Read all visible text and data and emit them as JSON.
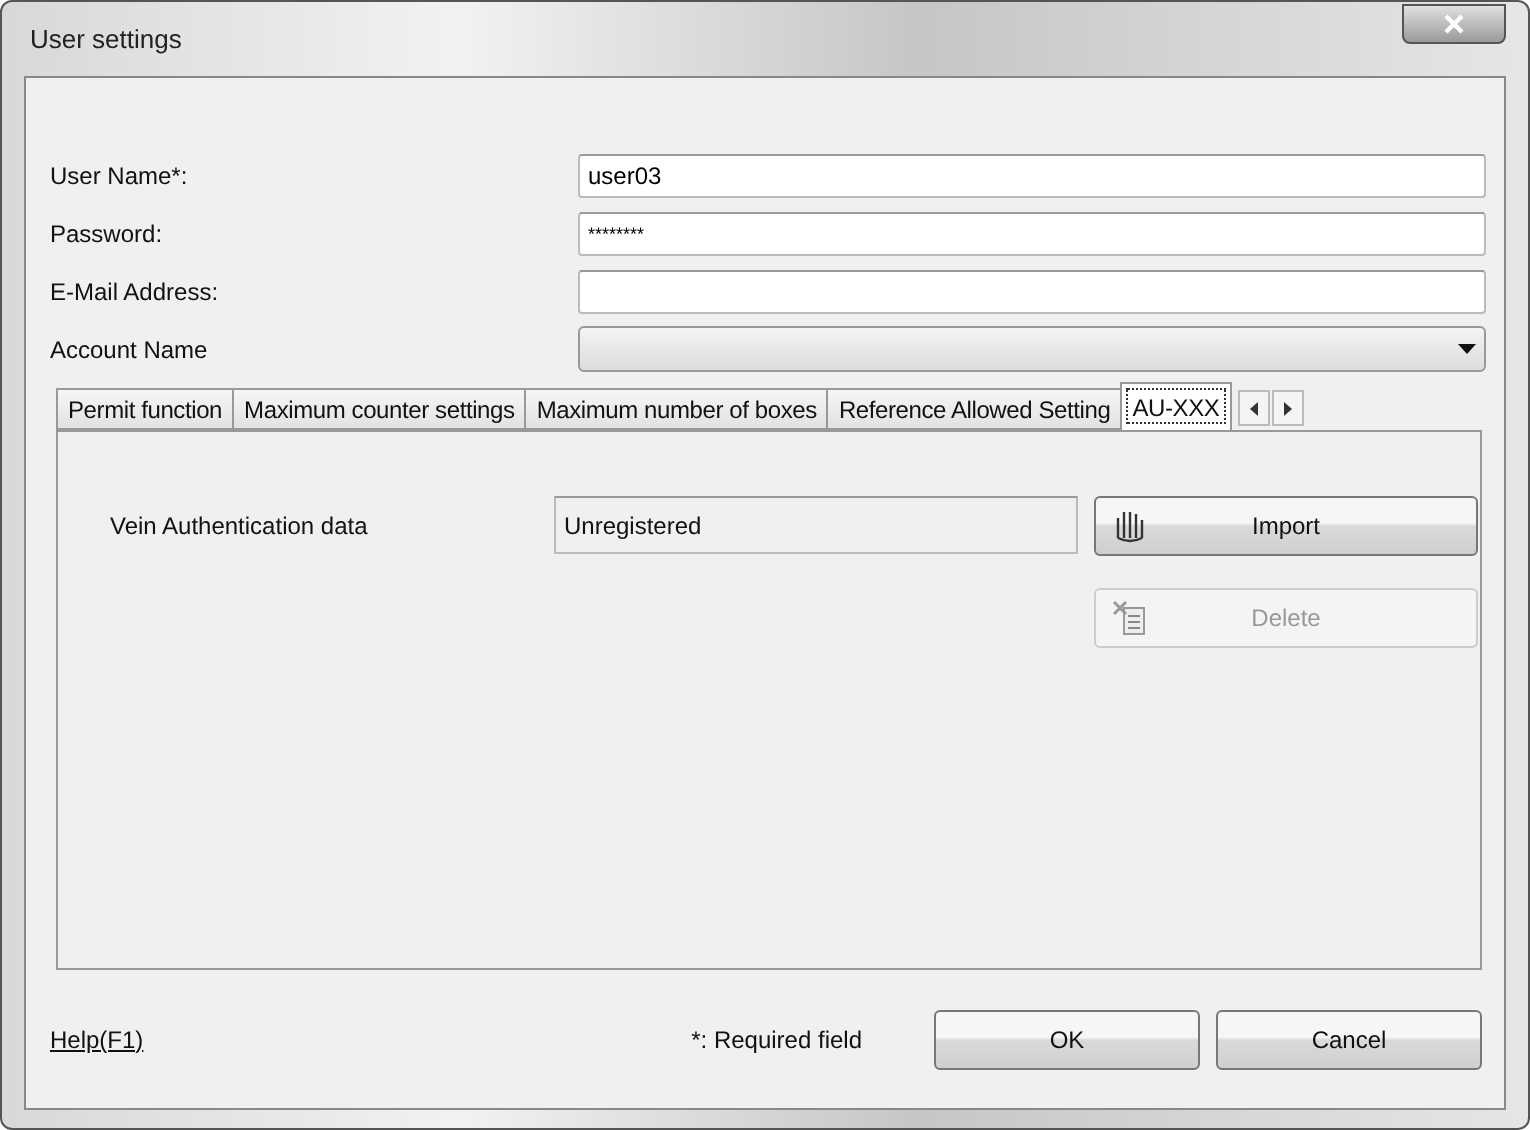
{
  "window": {
    "title": "User settings"
  },
  "fields": [
    {
      "label": "User Name*:",
      "value": "user03"
    },
    {
      "label": "Password:",
      "value": "********"
    },
    {
      "label": "E-Mail Address:"
    }
  ],
  "account": {
    "label": "Account Name"
  },
  "tabs": [
    {
      "label": "Permit function",
      "selected": false
    },
    {
      "label": "Maximum counter settings",
      "selected": false
    },
    {
      "label": "Maximum number of boxes",
      "selected": false
    },
    {
      "label": "Reference Allowed Setting",
      "selected": false
    },
    {
      "label": "AU-XXX",
      "selected": true
    }
  ],
  "vein": {
    "label": "Vein Authentication data",
    "status": "Unregistered",
    "buttons": [
      {
        "kind": "import",
        "label": "Import",
        "disabled": false
      },
      {
        "kind": "delete",
        "label": "Delete",
        "disabled": true
      }
    ]
  },
  "footer": {
    "help": "Help(F1)",
    "note": "*: Required field",
    "buttons": [
      "OK",
      "Cancel"
    ]
  }
}
